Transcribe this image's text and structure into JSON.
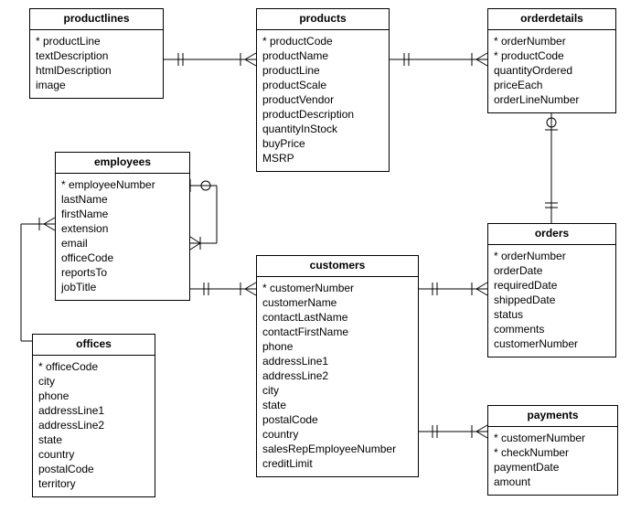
{
  "entities": {
    "productlines": {
      "title": "productlines",
      "fields": [
        "* productLine",
        "textDescription",
        "htmlDescription",
        "image"
      ]
    },
    "products": {
      "title": "products",
      "fields": [
        "* productCode",
        "productName",
        "productLine",
        "productScale",
        "productVendor",
        "productDescription",
        "quantityInStock",
        "buyPrice",
        "MSRP"
      ]
    },
    "orderdetails": {
      "title": "orderdetails",
      "fields": [
        "* orderNumber",
        "* productCode",
        "quantityOrdered",
        "priceEach",
        "orderLineNumber"
      ]
    },
    "employees": {
      "title": "employees",
      "fields": [
        "* employeeNumber",
        "lastName",
        "firstName",
        "extension",
        "email",
        "officeCode",
        "reportsTo",
        "jobTitle"
      ]
    },
    "customers": {
      "title": "customers",
      "fields": [
        "* customerNumber",
        "customerName",
        "contactLastName",
        "contactFirstName",
        "phone",
        "addressLine1",
        "addressLine2",
        "city",
        "state",
        "postalCode",
        "country",
        "salesRepEmployeeNumber",
        "creditLimit"
      ]
    },
    "orders": {
      "title": "orders",
      "fields": [
        "* orderNumber",
        "orderDate",
        "requiredDate",
        "shippedDate",
        "status",
        "comments",
        "customerNumber"
      ]
    },
    "offices": {
      "title": "offices",
      "fields": [
        "* officeCode",
        "city",
        "phone",
        "addressLine1",
        "addressLine2",
        "state",
        "country",
        "postalCode",
        "territory"
      ]
    },
    "payments": {
      "title": "payments",
      "fields": [
        "* customerNumber",
        "* checkNumber",
        "paymentDate",
        "amount"
      ]
    }
  },
  "relationships": [
    {
      "from": "productlines",
      "to": "products",
      "from_card": "one",
      "to_card": "many"
    },
    {
      "from": "products",
      "to": "orderdetails",
      "from_card": "one",
      "to_card": "many"
    },
    {
      "from": "orders",
      "to": "orderdetails",
      "from_card": "one",
      "to_card": "many"
    },
    {
      "from": "customers",
      "to": "orders",
      "from_card": "one",
      "to_card": "many"
    },
    {
      "from": "customers",
      "to": "payments",
      "from_card": "one",
      "to_card": "many"
    },
    {
      "from": "employees",
      "to": "customers",
      "from_card": "one",
      "to_card": "many"
    },
    {
      "from": "employees",
      "to": "employees",
      "from_card": "one",
      "to_card": "many",
      "note": "self-reference reportsTo"
    },
    {
      "from": "offices",
      "to": "employees",
      "from_card": "one",
      "to_card": "many"
    }
  ]
}
